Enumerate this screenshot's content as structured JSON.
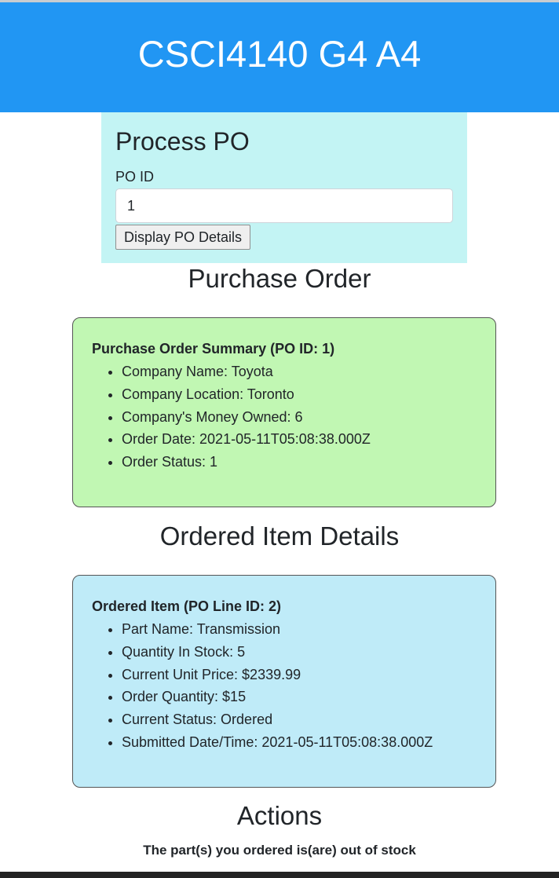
{
  "header": {
    "title": "CSCI4140 G4 A4"
  },
  "form": {
    "title": "Process PO",
    "po_id_label": "PO ID",
    "po_id_value": "1",
    "submit_label": "Display PO Details"
  },
  "purchase_order": {
    "section_title": "Purchase Order",
    "summary_title": "Purchase Order Summary (PO ID: 1)",
    "items": [
      "Company Name: Toyota",
      "Company Location: Toronto",
      "Company's Money Owned: 6",
      "Order Date: 2021-05-11T05:08:38.000Z",
      "Order Status: 1"
    ]
  },
  "ordered_items": {
    "section_title": "Ordered Item Details",
    "item_title": "Ordered Item (PO Line ID: 2)",
    "items": [
      "Part Name: Transmission",
      "Quantity In Stock: 5",
      "Current Unit Price: $2339.99",
      "Order Quantity: $15",
      "Current Status: Ordered",
      "Submitted Date/Time: 2021-05-11T05:08:38.000Z"
    ]
  },
  "actions": {
    "section_title": "Actions",
    "message": "The part(s) you ordered is(are) out of stock"
  },
  "colors": {
    "header": "#2196f3",
    "form_panel": "#c3f4f4",
    "po_card": "#c1f7b3",
    "item_card": "#bfebf8"
  }
}
